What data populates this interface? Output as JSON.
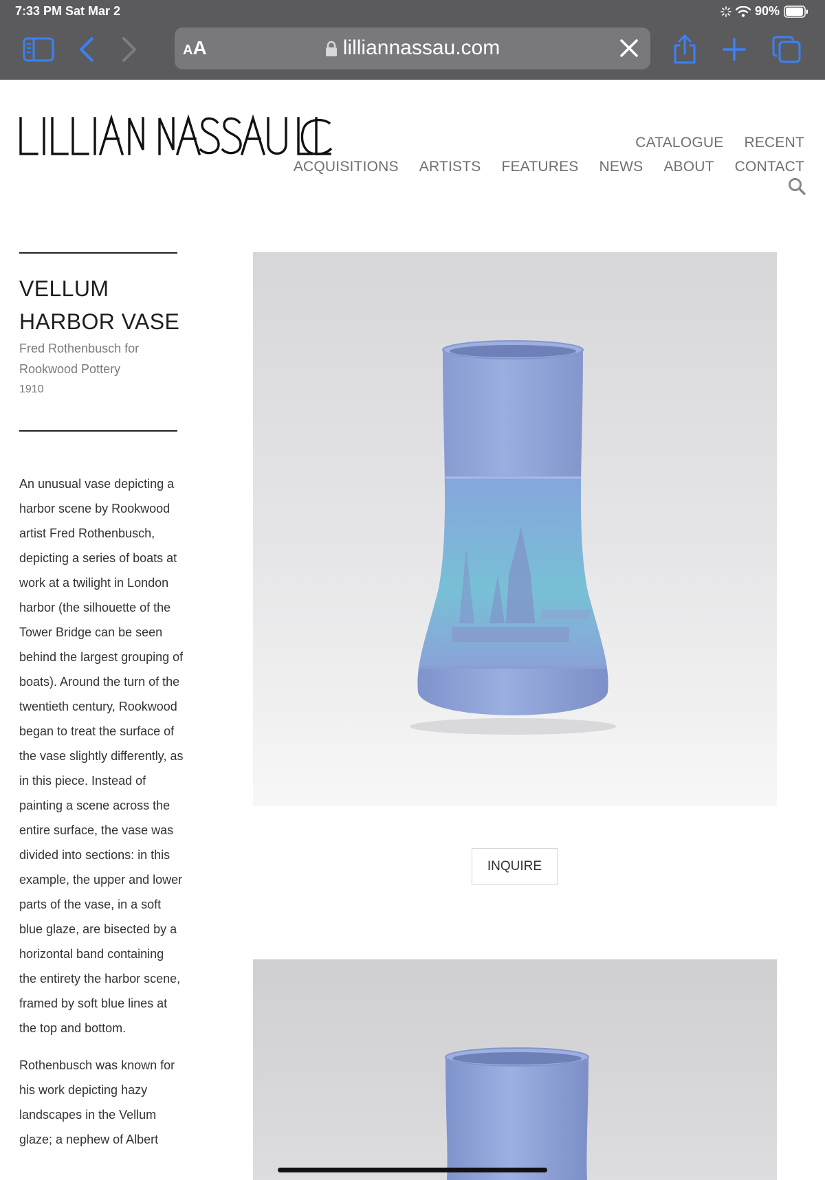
{
  "status_bar": {
    "time": "7:33 PM   Sat Mar 2",
    "battery": "90%"
  },
  "browser": {
    "text_size_label_small": "A",
    "text_size_label_large": "A",
    "url": "lilliannassau.com"
  },
  "site": {
    "logo_text": "LILLIAN NASSAU LLC",
    "nav_row1": [
      "CATALOGUE",
      "RECENT"
    ],
    "nav_row2": [
      "ACQUISITIONS",
      "ARTISTS",
      "FEATURES",
      "NEWS",
      "ABOUT",
      "CONTACT"
    ]
  },
  "item": {
    "title_line1": "VELLUM",
    "title_line2": "HARBOR VASE",
    "artist_line1": "Fred Rothenbusch for",
    "artist_line2": "Rookwood Pottery",
    "year": "1910",
    "description": [
      "An unusual vase depicting a harbor scene by Rookwood artist Fred Rothenbusch, depicting a series of boats at work at a twilight in London harbor (the silhouette of the Tower Bridge can be seen behind the largest grouping of boats). Around the turn of the twentieth century, Rookwood began to treat the surface of the vase slightly differently, as in this piece. Instead of painting a scene across the entire surface, the vase was divided into sections: in this example, the upper and lower parts of the vase, in a soft blue glaze, are bisected by a horizontal band containing the entirety the harbor scene, framed by soft blue lines at the top and bottom.",
      "Rothenbusch was known for his work depicting hazy landscapes in the Vellum glaze; a nephew of Albert"
    ],
    "inquire_label": "INQUIRE"
  },
  "colors": {
    "chrome_bg": "#5b5b5e",
    "accent_blue": "#3a82f7",
    "vase_blue": "#8ea3d8",
    "harbor_band": "#7fb6d8"
  }
}
